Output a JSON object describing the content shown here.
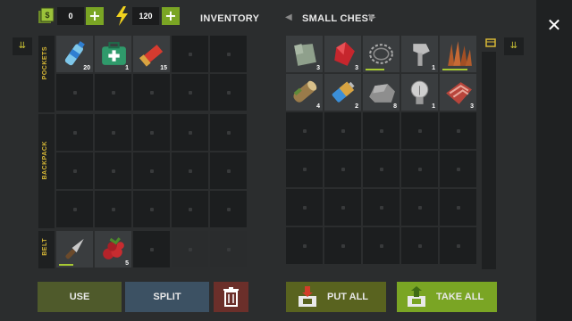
{
  "resources": {
    "money": {
      "value": "0",
      "icon": "money-icon"
    },
    "energy": {
      "value": "120",
      "icon": "lightning-icon"
    }
  },
  "titles": {
    "inventory": "INVENTORY",
    "container": "SMALL CHEST"
  },
  "labels": {
    "pockets": "POCKETS",
    "backpack": "BACKPACK",
    "belt": "BELT"
  },
  "inventory": {
    "pockets": [
      {
        "icon": "water-bottle-icon",
        "qty": "20"
      },
      {
        "icon": "first-aid-kit-icon",
        "qty": "1"
      },
      {
        "icon": "shotgun-shell-icon",
        "qty": "15"
      }
    ],
    "belt": [
      {
        "icon": "knife-icon",
        "qty": "",
        "durability": 0.45
      },
      {
        "icon": "berries-icon",
        "qty": "5"
      }
    ]
  },
  "chest": [
    {
      "icon": "cloth-icon",
      "qty": "3"
    },
    {
      "icon": "red-crystal-icon",
      "qty": "3"
    },
    {
      "icon": "barbed-wire-icon",
      "qty": "",
      "durability": 0.6
    },
    {
      "icon": "bolt-icon",
      "qty": "1"
    },
    {
      "icon": "spikes-icon",
      "qty": "",
      "durability": 0.8
    },
    {
      "icon": "wood-log-icon",
      "qty": "4"
    },
    {
      "icon": "battery-icon",
      "qty": "2"
    },
    {
      "icon": "stone-icon",
      "qty": "8"
    },
    {
      "icon": "light-bulb-icon",
      "qty": "1"
    },
    {
      "icon": "raw-meat-icon",
      "qty": "3"
    }
  ],
  "buttons": {
    "use": "USE",
    "split": "SPLIT",
    "put_all": "PUT ALL",
    "take_all": "TAKE ALL"
  },
  "colors": {
    "accent": "#7aa524",
    "label": "#d7b836",
    "use_bg": "#4f5a2b",
    "split_bg": "#3c5163",
    "trash_bg": "#6b2f2a",
    "put_bg": "#59631f",
    "take_bg": "#7aa524"
  }
}
